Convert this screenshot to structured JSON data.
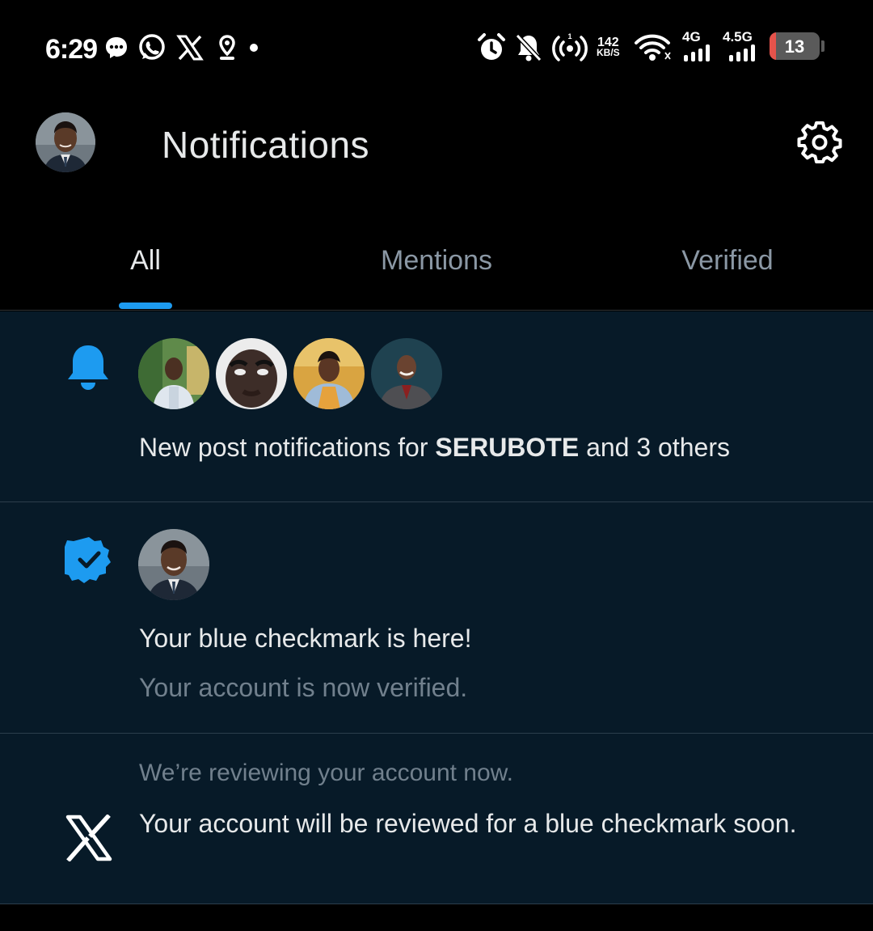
{
  "status_bar": {
    "time": "6:29",
    "speed_value": "142",
    "speed_unit": "KB/S",
    "net1": "4G",
    "net2": "4.5G",
    "battery": "13",
    "battery_level": 0.13
  },
  "header": {
    "title": "Notifications",
    "settings_icon": "gear-icon",
    "avatar_icon": "profile-avatar"
  },
  "tabs": [
    {
      "label": "All",
      "active": true
    },
    {
      "label": "Mentions",
      "active": false
    },
    {
      "label": "Verified",
      "active": false
    }
  ],
  "notifications": [
    {
      "icon": "bell-icon",
      "prefix": "New post notifications for ",
      "name": "SERUBOTE",
      "suffix": " and 3 others",
      "avatar_count": 4
    },
    {
      "icon": "verified-badge-icon",
      "title": "Your blue checkmark is here!",
      "subtitle": "Your account is now verified."
    },
    {
      "icon": "x-logo-icon",
      "subtitle": "We’re reviewing your account now.",
      "title": "Your account will be reviewed for a blue checkmark soon."
    }
  ],
  "colors": {
    "accent": "#1d9bf0",
    "feed_background": "#071a28",
    "muted_text": "#71808d"
  }
}
